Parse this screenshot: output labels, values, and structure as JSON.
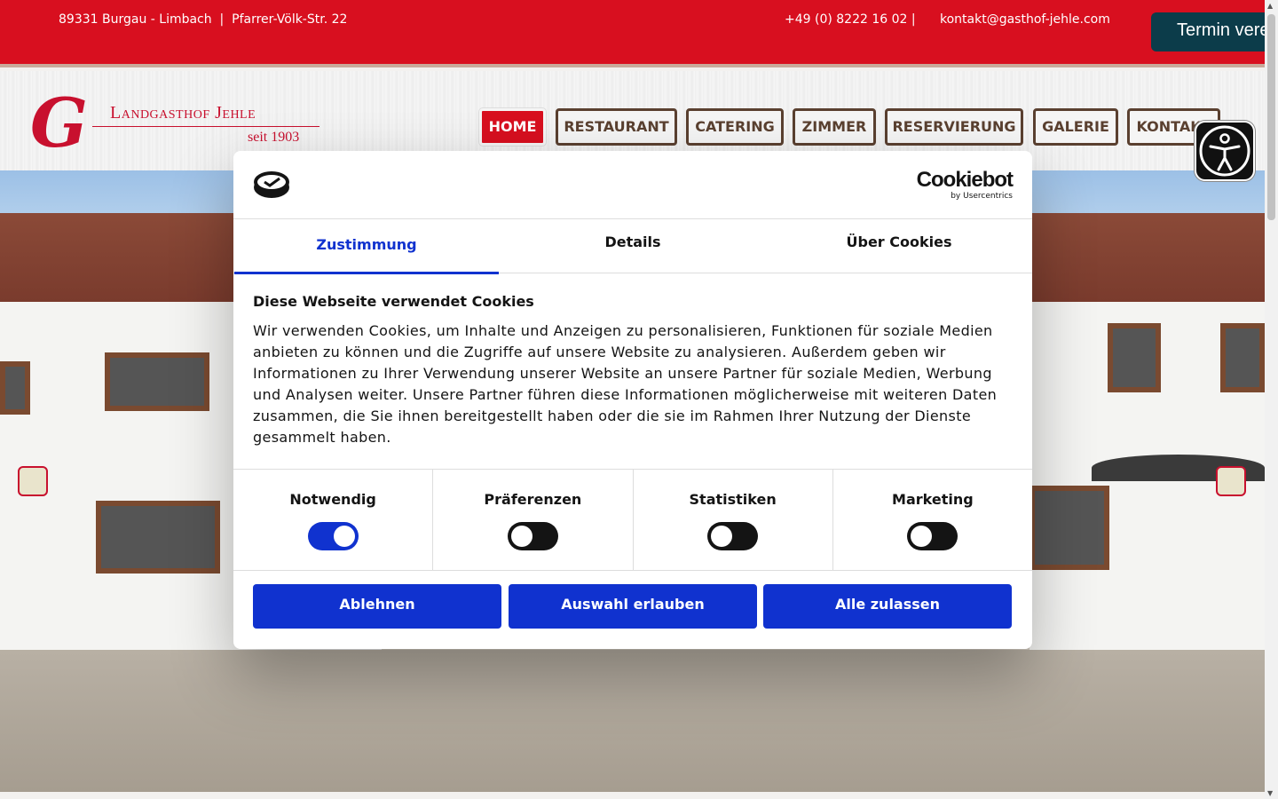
{
  "topbar": {
    "address": "89331 Burgau - Limbach  |  Pfarrer-Völk-Str. 22",
    "phone": "+49 (0) 8222 16 02  |",
    "email": "kontakt@gasthof-jehle.com",
    "termin_label": "Termin vere"
  },
  "logo": {
    "letter": "G",
    "name": "Landgasthof Jehle",
    "since": "seit 1903"
  },
  "nav": {
    "items": [
      {
        "label": "HOME",
        "active": true
      },
      {
        "label": "RESTAURANT"
      },
      {
        "label": "CATERING"
      },
      {
        "label": "ZIMMER"
      },
      {
        "label": "RESERVIERUNG"
      },
      {
        "label": "GALERIE"
      },
      {
        "label": "KONTAKT"
      }
    ]
  },
  "accessibility": {
    "icon": "accessibility-person-icon"
  },
  "cookie": {
    "brand": "Cookiebot",
    "brand_sub": "by Usercentrics",
    "tabs": [
      "Zustimmung",
      "Details",
      "Über Cookies"
    ],
    "active_tab": "Zustimmung",
    "heading": "Diese Webseite verwendet Cookies",
    "text": "Wir verwenden Cookies, um Inhalte und Anzeigen zu personalisieren, Funktionen für soziale Medien anbieten zu können und die Zugriffe auf unsere Website zu analysieren. Außerdem geben wir Informationen zu Ihrer Verwendung unserer Website an unsere Partner für soziale Medien, Werbung und Analysen weiter. Unsere Partner führen diese Informationen möglicherweise mit weiteren Daten zusammen, die Sie ihnen bereitgestellt haben oder die sie im Rahmen Ihrer Nutzung der Dienste gesammelt haben.",
    "categories": [
      {
        "label": "Notwendig",
        "enabled": true
      },
      {
        "label": "Präferenzen",
        "enabled": false
      },
      {
        "label": "Statistiken",
        "enabled": false
      },
      {
        "label": "Marketing",
        "enabled": false
      }
    ],
    "buttons": {
      "decline": "Ablehnen",
      "allow_selection": "Auswahl erlauben",
      "allow_all": "Alle zulassen"
    }
  },
  "colors": {
    "brand_red": "#d80f1f",
    "cookie_blue": "#1032cf",
    "nav_brown": "#5a4030",
    "termin_teal": "#0c3c4a"
  }
}
